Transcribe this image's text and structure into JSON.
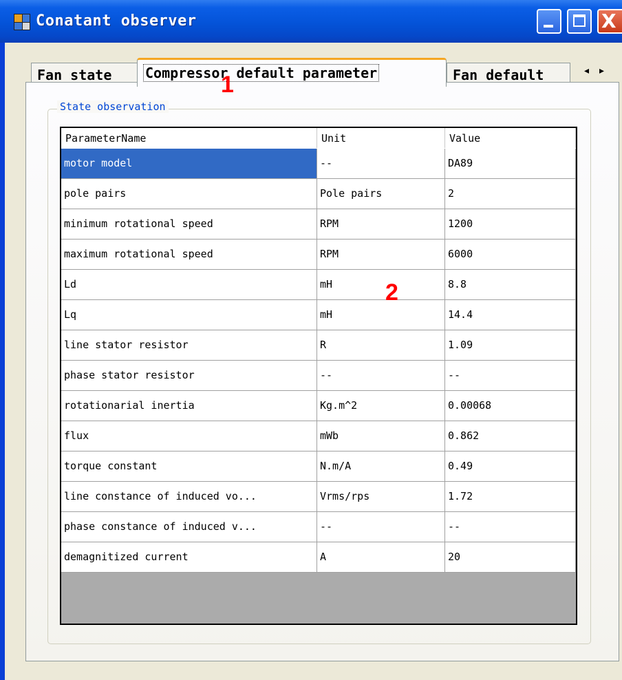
{
  "window": {
    "title": "Conatant observer",
    "icons": {
      "app": "app-window-icon",
      "minimize": "minimize-icon",
      "maximize": "maximize-icon",
      "close": "close-icon"
    },
    "close_glyph": "X"
  },
  "tabs": [
    {
      "label": "Fan state",
      "active": false
    },
    {
      "label": "Compressor default parameter",
      "active": true
    },
    {
      "label": "Fan default",
      "active": false
    }
  ],
  "tab_scroll": {
    "left": "◂",
    "right": "▸"
  },
  "annotations": {
    "marker1": "1",
    "marker2": "2"
  },
  "group": {
    "title": "State observation"
  },
  "grid": {
    "columns": [
      "ParameterName",
      "Unit",
      "Value"
    ],
    "rows": [
      {
        "name": "motor model",
        "unit": "--",
        "value": "DA89",
        "selected": true
      },
      {
        "name": "pole pairs",
        "unit": "Pole pairs",
        "value": "2"
      },
      {
        "name": "minimum rotational speed",
        "unit": "RPM",
        "value": "1200"
      },
      {
        "name": "maximum rotational speed",
        "unit": "RPM",
        "value": "6000"
      },
      {
        "name": "Ld",
        "unit": "mH",
        "value": "8.8"
      },
      {
        "name": "Lq",
        "unit": "mH",
        "value": "14.4"
      },
      {
        "name": "line stator resistor",
        "unit": "R",
        "value": "1.09"
      },
      {
        "name": "phase stator resistor",
        "unit": "--",
        "value": "--"
      },
      {
        "name": "rotationarial inertia",
        "unit": "Kg.m^2",
        "value": "0.00068"
      },
      {
        "name": "flux",
        "unit": "mWb",
        "value": "0.862"
      },
      {
        "name": "torque constant",
        "unit": "N.m/A",
        "value": "0.49"
      },
      {
        "name": "line constance of induced vo...",
        "unit": "Vrms/rps",
        "value": "1.72"
      },
      {
        "name": "phase constance of induced v...",
        "unit": "--",
        "value": "--"
      },
      {
        "name": "demagnitized current",
        "unit": "A",
        "value": "20"
      }
    ]
  },
  "colors": {
    "titlebar": "#0453d8",
    "selection": "#316ac5",
    "active_tab_accent": "#f5a623",
    "group_title": "#0046d5",
    "annotation": "#ff0000",
    "grid_background": "#ababab"
  }
}
